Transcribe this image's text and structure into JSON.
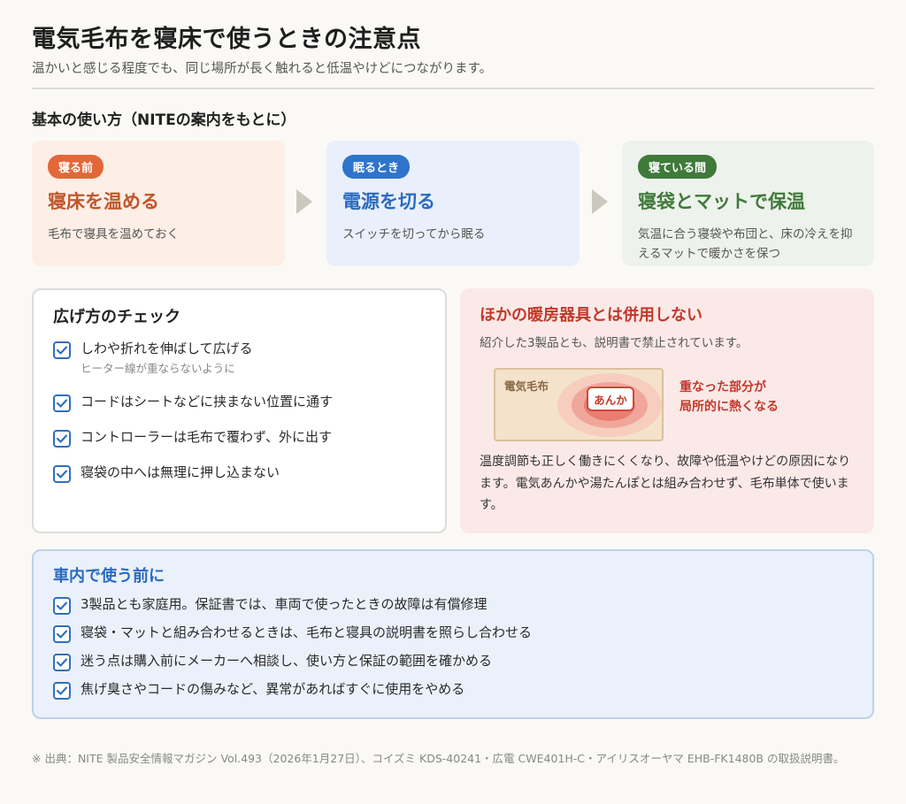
{
  "header": {
    "title": "電気毛布を寝床で使うときの注意点",
    "subtitle": "温かいと感じる程度でも、同じ場所が長く触れると低温やけどにつながります。"
  },
  "basic_usage": {
    "title": "基本の使い方（NITEの案内をもとに）",
    "steps": [
      {
        "badge": "寝る前",
        "heading": "寝床を温める",
        "desc": "毛布で寝具を温めておく"
      },
      {
        "badge": "眠るとき",
        "heading": "電源を切る",
        "desc": "スイッチを切ってから眠る"
      },
      {
        "badge": "寝ている間",
        "heading": "寝袋とマットで保温",
        "desc": "気温に合う寝袋や布団と、床の冷えを抑えるマットで暖かさを保つ"
      }
    ]
  },
  "spread_check": {
    "title": "広げ方のチェック",
    "items": [
      {
        "text": "しわや折れを伸ばして広げる",
        "sub": "ヒーター線が重ならないように"
      },
      {
        "text": "コードはシートなどに挟まない位置に通す"
      },
      {
        "text": "コントローラーは毛布で覆わず、外に出す"
      },
      {
        "text": "寝袋の中へは無理に押し込まない"
      }
    ]
  },
  "no_other_heaters": {
    "title": "ほかの暖房器具とは併用しない",
    "subtitle": "紹介した3製品とも、説明書で禁止されています。",
    "blanket_label": "電気毛布",
    "anka_label": "あんか",
    "overlap_note_line1": "重なった部分が",
    "overlap_note_line2": "局所的に熱くなる",
    "body": "温度調節も正しく働きにくくなり、故障や低温やけどの原因になります。電気あんかや湯たんぽとは組み合わせず、毛布単体で使います。"
  },
  "car_use": {
    "title": "車内で使う前に",
    "items": [
      "3製品とも家庭用。保証書では、車両で使ったときの故障は有償修理",
      "寝袋・マットと組み合わせるときは、毛布と寝具の説明書を照らし合わせる",
      "迷う点は購入前にメーカーへ相談し、使い方と保証の範囲を確かめる",
      "焦げ臭さやコードの傷みなど、異常があればすぐに使用をやめる"
    ]
  },
  "footer": {
    "source": "※ 出典：NITE 製品安全情報マガジン Vol.493（2026年1月27日）、コイズミ KDS-40241・広電 CWE401H-C・アイリスオーヤマ EHB-FK1480B の取扱説明書。"
  },
  "colors": {
    "step1_accent": "#e2683a",
    "step2_accent": "#2f74cc",
    "step3_accent": "#3f7a3a",
    "warning_red": "#c2392b",
    "checkbox_blue": "#2f6fbf"
  }
}
